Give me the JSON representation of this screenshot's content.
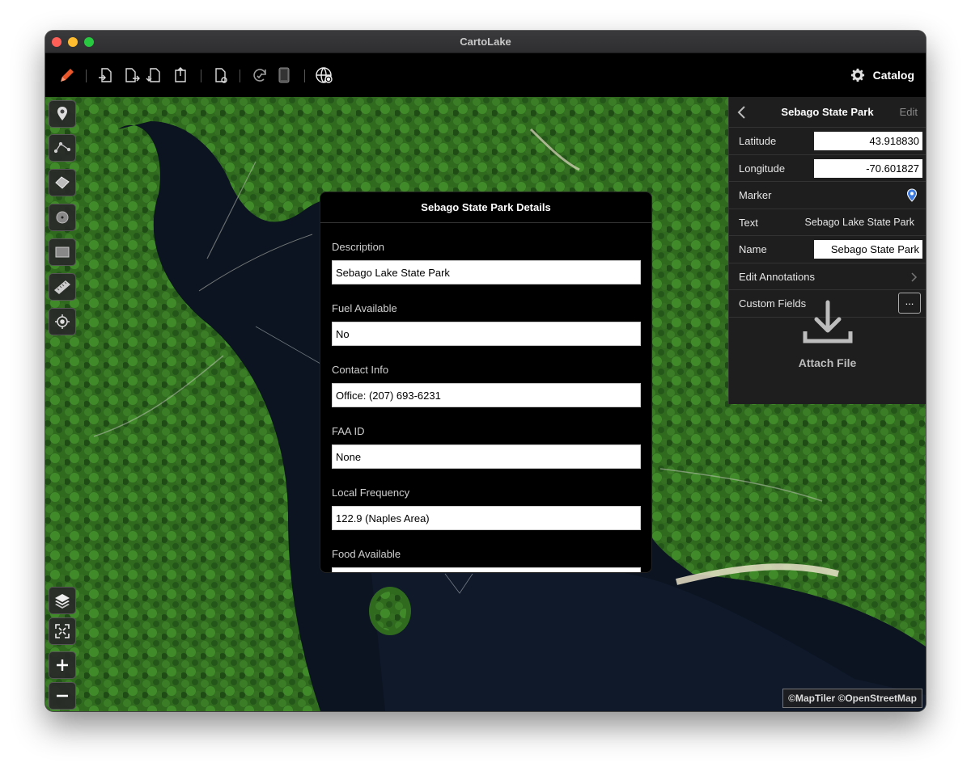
{
  "app": {
    "title": "CartoLake"
  },
  "toolbar": {
    "catalog_label": "Catalog",
    "icons": [
      "pencil-icon",
      "import-file-icon",
      "export-file-icon",
      "download-file-icon",
      "share-file-icon",
      "file-settings-icon",
      "sync-icon",
      "tablet-icon",
      "globe-settings-icon"
    ]
  },
  "map": {
    "attribution": "©MapTiler  ©OpenStreetMap"
  },
  "dialog": {
    "title": "Sebago State Park Details",
    "fields": [
      {
        "label": "Description",
        "value": "Sebago Lake State Park"
      },
      {
        "label": "Fuel Available",
        "value": "No"
      },
      {
        "label": "Contact Info",
        "value": "Office: (207) 693-6231"
      },
      {
        "label": "FAA ID",
        "value": "None"
      },
      {
        "label": "Local Frequency",
        "value": "122.9 (Naples Area)"
      },
      {
        "label": "Food Available",
        "value": ""
      }
    ]
  },
  "panel": {
    "title": "Sebago State Park",
    "edit_label": "Edit",
    "latitude": {
      "label": "Latitude",
      "value": "43.918830"
    },
    "longitude": {
      "label": "Longitude",
      "value": "-70.601827"
    },
    "marker": {
      "label": "Marker"
    },
    "text": {
      "label": "Text",
      "value": "Sebago Lake State Park"
    },
    "name": {
      "label": "Name",
      "value": "Sebago State Park"
    },
    "edit_annotations": {
      "label": "Edit Annotations"
    },
    "custom_fields": {
      "label": "Custom Fields",
      "button": "..."
    },
    "attach_label": "Attach File"
  },
  "colors": {
    "accent": "#e8562a",
    "marker": "#3d7be0"
  }
}
